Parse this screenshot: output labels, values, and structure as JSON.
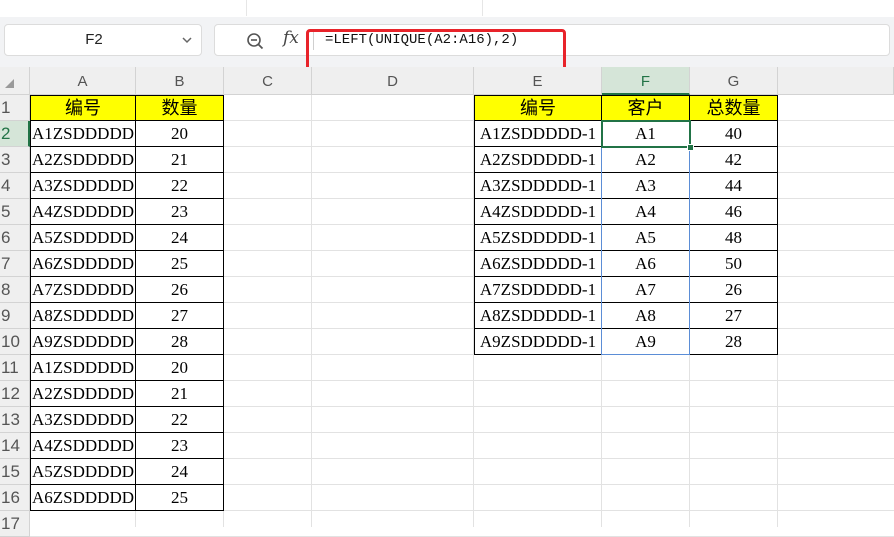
{
  "name_box": {
    "value": "F2"
  },
  "formula_bar": {
    "formula": "=LEFT(UNIQUE(A2:A16),2)"
  },
  "columns": [
    "A",
    "B",
    "C",
    "D",
    "E",
    "F",
    "G"
  ],
  "rows": [
    "1",
    "2",
    "3",
    "4",
    "5",
    "6",
    "7",
    "8",
    "9",
    "10",
    "11",
    "12",
    "13",
    "14",
    "15",
    "16",
    "17"
  ],
  "table1": {
    "headers": [
      "编号",
      "数量"
    ],
    "rows": [
      [
        "A1ZSDDDDD",
        "20"
      ],
      [
        "A2ZSDDDDD",
        "21"
      ],
      [
        "A3ZSDDDDD",
        "22"
      ],
      [
        "A4ZSDDDDD",
        "23"
      ],
      [
        "A5ZSDDDDD",
        "24"
      ],
      [
        "A6ZSDDDDD",
        "25"
      ],
      [
        "A7ZSDDDDD",
        "26"
      ],
      [
        "A8ZSDDDDD",
        "27"
      ],
      [
        "A9ZSDDDDD",
        "28"
      ],
      [
        "A1ZSDDDDD",
        "20"
      ],
      [
        "A2ZSDDDDD",
        "21"
      ],
      [
        "A3ZSDDDDD",
        "22"
      ],
      [
        "A4ZSDDDDD",
        "23"
      ],
      [
        "A5ZSDDDDD",
        "24"
      ],
      [
        "A6ZSDDDDD",
        "25"
      ]
    ]
  },
  "table2": {
    "headers": [
      "编号",
      "客户",
      "总数量"
    ],
    "rows": [
      [
        "A1ZSDDDDD-1",
        "A1",
        "40"
      ],
      [
        "A2ZSDDDDD-1",
        "A2",
        "42"
      ],
      [
        "A3ZSDDDDD-1",
        "A3",
        "44"
      ],
      [
        "A4ZSDDDDD-1",
        "A4",
        "46"
      ],
      [
        "A5ZSDDDDD-1",
        "A5",
        "48"
      ],
      [
        "A6ZSDDDDD-1",
        "A6",
        "50"
      ],
      [
        "A7ZSDDDDD-1",
        "A7",
        "26"
      ],
      [
        "A8ZSDDDDD-1",
        "A8",
        "27"
      ],
      [
        "A9ZSDDDDD-1",
        "A9",
        "28"
      ]
    ]
  },
  "selected_column": "F",
  "selected_row": "2",
  "colors": {
    "header_fill": "#ffff00",
    "selection": "#217346",
    "spill_border": "#5b8dd6",
    "annotation": "#e8232a"
  }
}
